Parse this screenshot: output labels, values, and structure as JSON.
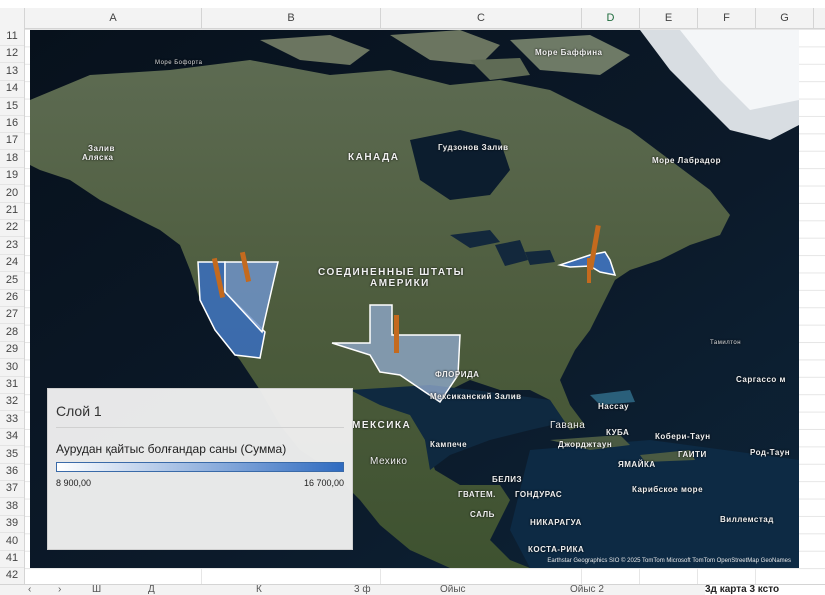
{
  "columns": [
    "A",
    "B",
    "C",
    "D",
    "E",
    "F",
    "G"
  ],
  "selected_column": "D",
  "rows": [
    "11",
    "12",
    "13",
    "14",
    "15",
    "16",
    "17",
    "18",
    "19",
    "20",
    "21",
    "22",
    "23",
    "24",
    "25",
    "26",
    "27",
    "28",
    "29",
    "30",
    "31",
    "32",
    "33",
    "34",
    "35",
    "36",
    "37",
    "38",
    "39",
    "40",
    "41",
    "42"
  ],
  "map": {
    "labels": {
      "canada": "КАНАДА",
      "usa1": "СОЕДИНЕННЫЕ ШТАТЫ",
      "usa2": "АМЕРИКИ",
      "mexico": "МЕКСИКА",
      "mexico_city": "Мехико",
      "hudson_bay": "Гудзонов Залив",
      "labrador_sea": "Море Лабрадор",
      "baffin_sea": "Море Баффина",
      "beaufort_sea": "Море Бофорта",
      "alaska_gulf1": "Залив",
      "alaska_gulf2": "Аляска",
      "gulf_mexico": "Мексиканский Залив",
      "cuba": "КУБА",
      "havana": "Гавана",
      "jamaica": "ЯМАЙКА",
      "haiti": "ГАИТИ",
      "caribbean": "Карибское море",
      "belize": "БЕЛИЗ",
      "guatemala": "ГВАТЕМ.",
      "honduras": "ГОНДУРАС",
      "salvador": "САЛЬ",
      "nicaragua": "НИКАРАГУА",
      "costa_rica": "КОСТА-РИКА",
      "kampeche": "Кампече",
      "georgetown": "Джорджтаун",
      "nassau": "Нассау",
      "florida": "ФЛОРИДА",
      "kober": "Кобери-Таун",
      "road_town": "Род-Таун",
      "sargasso": "Саргассо м",
      "willemstad": "Виллемстад",
      "tamilton": "Тамилтон"
    },
    "attribution": "Earthstar Geographics  SIO  © 2025 TomTom  Microsoft  TomTom  OpenStreetMap  GeoNames"
  },
  "legend": {
    "title": "Слой 1",
    "field": "Аурудан қайтыс болғандар саны (Сумма)",
    "min": "8 900,00",
    "max": "16 700,00",
    "color_low": "#ffffff",
    "color_high": "#2f6bc0"
  },
  "sheet_tabs": [
    "Ш",
    "Д",
    "К",
    "3 ф",
    "Ойыс",
    "Ойыс 2",
    "3д карта 3 ксто"
  ]
}
